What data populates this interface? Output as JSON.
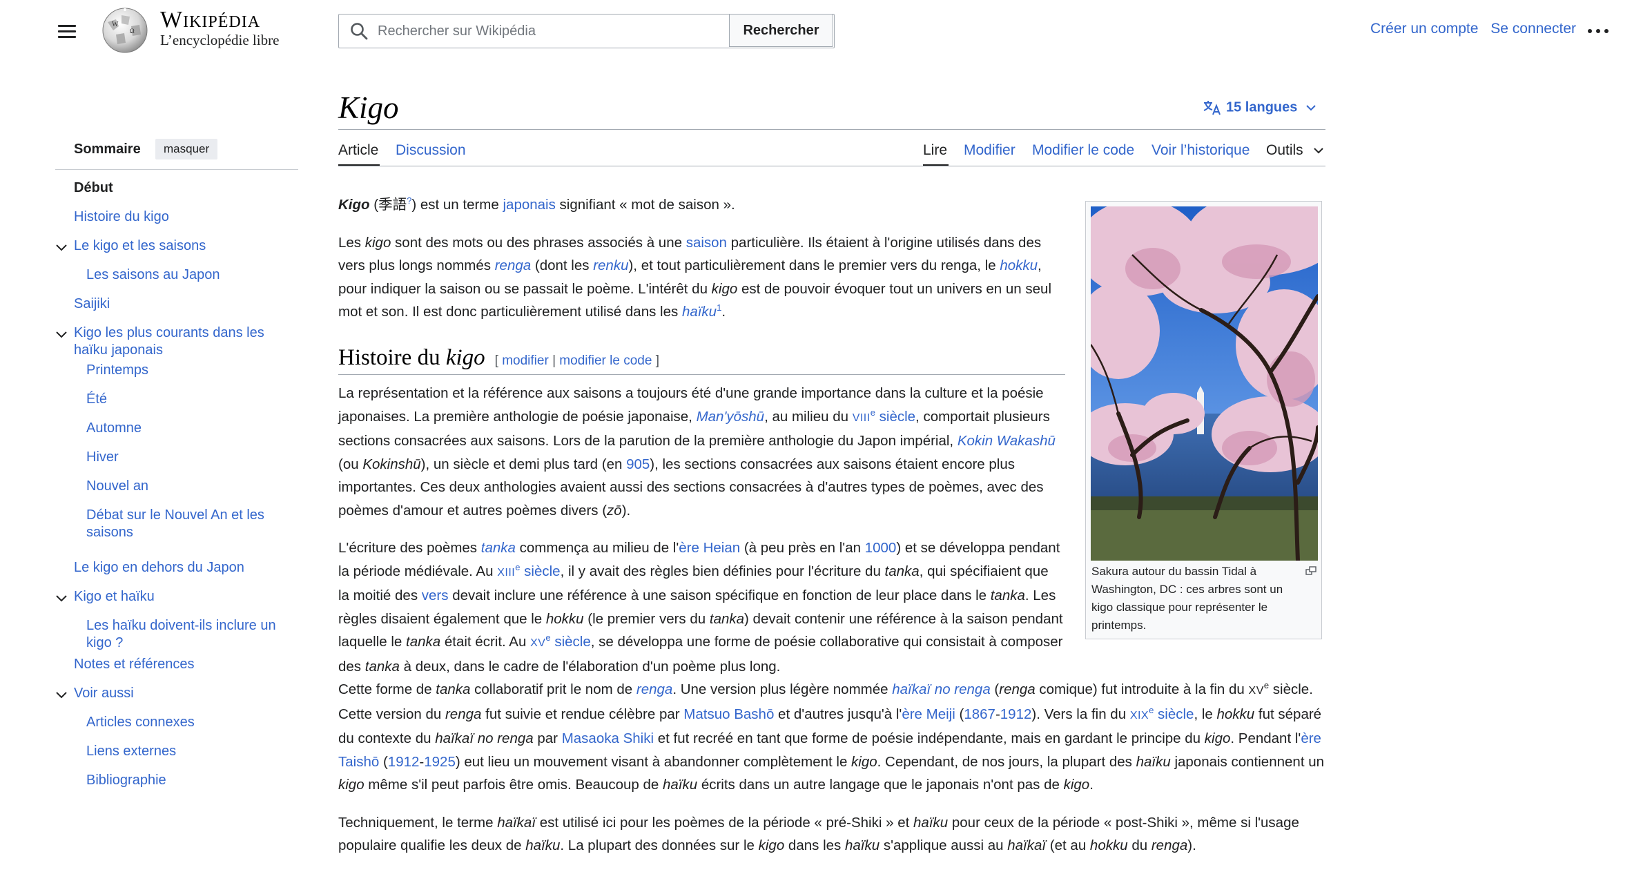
{
  "header": {
    "logo_wordmark": "Wikipédia",
    "logo_tagline": "L’encyclopédie libre",
    "search_placeholder": "Rechercher sur Wikipédia",
    "search_button": "Rechercher",
    "create_account": "Créer un compte",
    "login": "Se connecter"
  },
  "toc": {
    "title": "Sommaire",
    "hide_label": "masquer",
    "items": [
      {
        "label": "Début",
        "level": 1,
        "active": true
      },
      {
        "label": "Histoire du kigo",
        "level": 1
      },
      {
        "label": "Le kigo et les saisons",
        "level": 1,
        "expandable": true
      },
      {
        "label": "Les saisons au Japon",
        "level": 2
      },
      {
        "label": "Saijiki",
        "level": 1
      },
      {
        "label": "Kigo les plus courants dans les haïku japonais",
        "level": 1,
        "expandable": true
      },
      {
        "label": "Printemps",
        "level": 2
      },
      {
        "label": "Été",
        "level": 2
      },
      {
        "label": "Automne",
        "level": 2
      },
      {
        "label": "Hiver",
        "level": 2
      },
      {
        "label": "Nouvel an",
        "level": 2
      },
      {
        "label": "Débat sur le Nouvel An et les saisons",
        "level": 2
      },
      {
        "label": "Le kigo en dehors du Japon",
        "level": 1
      },
      {
        "label": "Kigo et haïku",
        "level": 1,
        "expandable": true
      },
      {
        "label": "Les haïku doivent-ils inclure un kigo ?",
        "level": 2
      },
      {
        "label": "Notes et références",
        "level": 1
      },
      {
        "label": "Voir aussi",
        "level": 1,
        "expandable": true
      },
      {
        "label": "Articles connexes",
        "level": 2
      },
      {
        "label": "Liens externes",
        "level": 2
      },
      {
        "label": "Bibliographie",
        "level": 2
      }
    ]
  },
  "page": {
    "title": "Kigo",
    "languages": "15 langues",
    "tabs_left": [
      "Article",
      "Discussion"
    ],
    "tabs_right": [
      "Lire",
      "Modifier",
      "Modifier le code",
      "Voir l’historique",
      "Outils"
    ]
  },
  "section": {
    "heading": "Histoire du kigo",
    "edit_open": "[",
    "edit_link1": "modifier",
    "edit_sep": "|",
    "edit_link2": "modifier le code",
    "edit_close": "]"
  },
  "thumb": {
    "caption": "Sakura autour du bassin Tidal à Washington, DC : ces arbres sont un kigo classique pour représenter le printemps."
  },
  "colors": {
    "link": "#3366cc",
    "text": "#202122",
    "border": "#a2a9b1"
  }
}
